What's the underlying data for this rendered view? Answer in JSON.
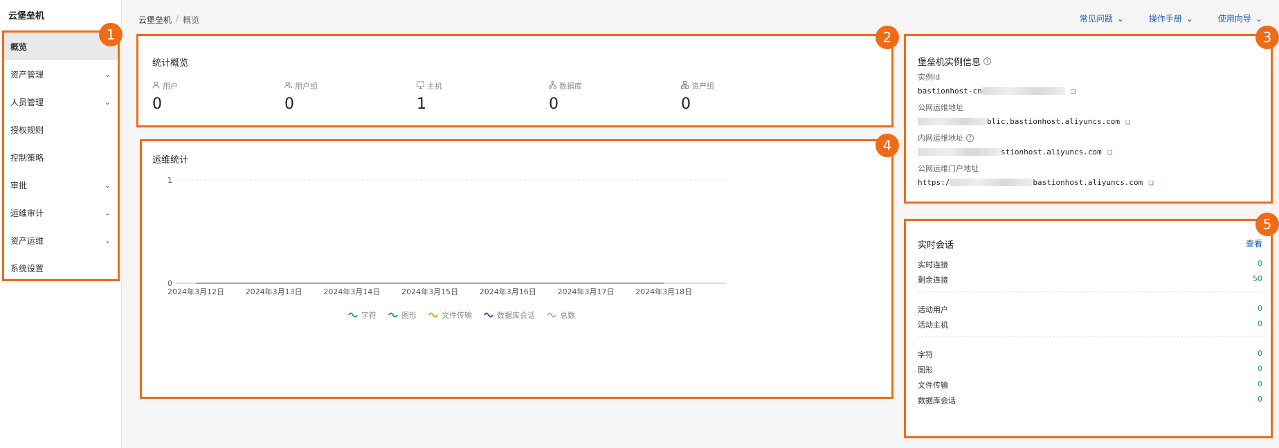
{
  "app": {
    "title": "云堡垒机"
  },
  "sidebar": {
    "items": [
      {
        "label": "概览",
        "expandable": false,
        "active": true
      },
      {
        "label": "资产管理",
        "expandable": true
      },
      {
        "label": "人员管理",
        "expandable": true
      },
      {
        "label": "授权规则",
        "expandable": false
      },
      {
        "label": "控制策略",
        "expandable": false
      },
      {
        "label": "审批",
        "expandable": true
      },
      {
        "label": "运维审计",
        "expandable": true
      },
      {
        "label": "资产运维",
        "expandable": true
      },
      {
        "label": "系统设置",
        "expandable": false
      }
    ]
  },
  "breadcrumb": {
    "root": "云堡垒机",
    "sep": "/",
    "current": "概览"
  },
  "top_links": [
    {
      "label": "常见问题"
    },
    {
      "label": "操作手册"
    },
    {
      "label": "使用向导"
    }
  ],
  "markers": [
    "1",
    "2",
    "3",
    "4",
    "5"
  ],
  "stats": {
    "title": "统计概览",
    "items": [
      {
        "label": "用户",
        "value": "0",
        "icon": "user-icon"
      },
      {
        "label": "用户组",
        "value": "0",
        "icon": "user-group-icon"
      },
      {
        "label": "主机",
        "value": "1",
        "icon": "monitor-icon"
      },
      {
        "label": "数据库",
        "value": "0",
        "icon": "database-icon"
      },
      {
        "label": "资产组",
        "value": "0",
        "icon": "asset-group-icon"
      }
    ]
  },
  "ops": {
    "title": "运维统计"
  },
  "chart_data": {
    "type": "line",
    "x": [
      "2024年3月12日",
      "2024年3月13日",
      "2024年3月14日",
      "2024年3月15日",
      "2024年3月16日",
      "2024年3月17日",
      "2024年3月18日"
    ],
    "yticks": [
      "0",
      "1"
    ],
    "ylim": [
      0,
      1
    ],
    "series": [
      {
        "name": "字符",
        "color": "#1aa39a",
        "values": [
          0,
          0,
          0,
          0,
          0,
          0,
          0
        ]
      },
      {
        "name": "图形",
        "color": "#1a8fb0",
        "values": [
          0,
          0,
          0,
          0,
          0,
          0,
          0
        ]
      },
      {
        "name": "文件传输",
        "color": "#e0a800",
        "values": [
          0,
          0,
          0,
          0,
          0,
          0,
          0
        ]
      },
      {
        "name": "数据库会话",
        "color": "#7b3f8f",
        "values": [
          0,
          0,
          0,
          0,
          0,
          0,
          0
        ]
      },
      {
        "name": "总数",
        "color": "#b5b5b5",
        "values": [
          0,
          0,
          0,
          0,
          0,
          0,
          0
        ]
      }
    ],
    "legend": "bottom",
    "grid": true
  },
  "instance": {
    "title": "堡垒机实例信息",
    "id_label": "实例Id",
    "id_value_prefix": "bastionhost-cn",
    "public_label": "公网运维地址",
    "public_value_suffix": "blic.bastionhost.aliyuncs.com",
    "private_label": "内网运维地址",
    "private_value_suffix": "stionhost.aliyuncs.com",
    "portal_label": "公网运维门户地址",
    "portal_value_prefix": "https:/",
    "portal_value_suffix": "bastionhost.aliyuncs.com"
  },
  "live": {
    "title": "实时会话",
    "view_label": "查看",
    "rows": [
      {
        "label": "实时连接",
        "value": "0"
      },
      {
        "label": "剩余连接",
        "value": "50"
      },
      {
        "label": "活动用户",
        "value": "0"
      },
      {
        "label": "活动主机",
        "value": "0"
      },
      {
        "label": "字符",
        "value": "0"
      },
      {
        "label": "图形",
        "value": "0"
      },
      {
        "label": "文件传输",
        "value": "0"
      },
      {
        "label": "数据库会话",
        "value": "0"
      }
    ]
  }
}
